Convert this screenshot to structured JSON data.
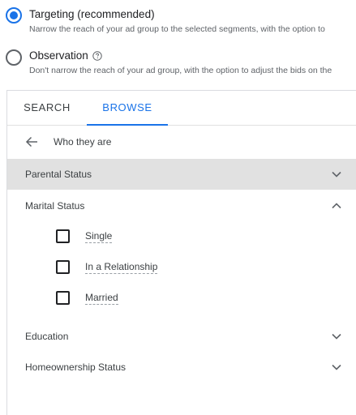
{
  "targeting_options": [
    {
      "title": "Targeting (recommended)",
      "description": "Narrow the reach of your ad group to the selected segments, with the option to",
      "selected": true
    },
    {
      "title": "Observation",
      "description": "Don't narrow the reach of your ad group, with the option to adjust the bids on the",
      "selected": false,
      "icon": "help-icon"
    }
  ],
  "tabs": [
    {
      "label": "SEARCH",
      "active": false
    },
    {
      "label": "BROWSE",
      "active": true
    }
  ],
  "breadcrumb": {
    "back_icon": "arrow-back-icon",
    "label": "Who they are"
  },
  "categories": {
    "parental_status": {
      "label": "Parental Status",
      "expanded": false
    },
    "marital_status": {
      "label": "Marital Status",
      "expanded": true,
      "options": [
        {
          "label": "Single",
          "checked": false
        },
        {
          "label": "In a Relationship",
          "checked": false
        },
        {
          "label": "Married",
          "checked": false
        }
      ]
    },
    "education": {
      "label": "Education",
      "expanded": false
    },
    "homeownership_status": {
      "label": "Homeownership Status",
      "expanded": false
    }
  },
  "colors": {
    "accent": "#1a73e8",
    "selected_row": "#e1e1e1",
    "border": "#dadce0"
  }
}
